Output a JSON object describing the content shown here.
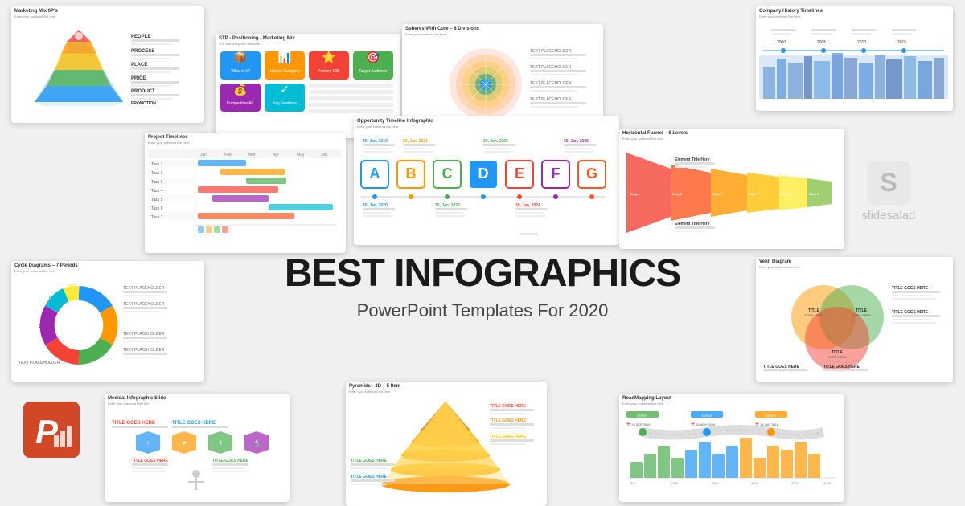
{
  "page": {
    "title": "Best Infographics PowerPoint Templates For 2020",
    "main_title": "BEST INFOGRAPHICS",
    "sub_title": "PowerPoint Templates For 2020"
  },
  "slides": {
    "marketing": {
      "title": "Marketing Mix 6P's",
      "subtitle": "Enter your subhead line here",
      "labels": [
        "PEOPLE",
        "PROCESS",
        "PLACE",
        "PRICE",
        "PRODUCT",
        "PROMOTION"
      ]
    },
    "stp": {
      "title": "STP - Positioning - Marketing Mix",
      "subtitle": "STP Marketing Mix Template",
      "cells": [
        "What is it?",
        "Market Category",
        "Primary Differentiation",
        "Target Audience",
        "Competitive Alternatives",
        "Key Features"
      ]
    },
    "spheres": {
      "title": "Spheres With Core – 8 Divisions",
      "subtitle": "Enter your subhead line here"
    },
    "company": {
      "title": "Company History Timelines",
      "subtitle": "Enter your subhead line here"
    },
    "project": {
      "title": "Project Timelines",
      "subtitle": "Enter your subhead line here"
    },
    "opportunity": {
      "title": "Opportunity Timeline Infographic",
      "subtitle": "Enter your subhead line here",
      "letters": [
        "A",
        "B",
        "C",
        "D",
        "E",
        "F",
        "G"
      ]
    },
    "funnel": {
      "title": "Horizontal Funnel – 6 Levels",
      "subtitle": "Enter your subhead line here"
    },
    "cycle": {
      "title": "Cycle Diagrams – 7 Periods",
      "subtitle": "Enter your subhead line here",
      "labels": [
        "01",
        "02",
        "03",
        "04",
        "05",
        "06",
        "07"
      ]
    },
    "venn": {
      "title": "Venn Diagram",
      "subtitle": "Enter your subhead line here"
    },
    "ppt": {
      "label": "P"
    },
    "medical": {
      "title": "Medical Infographic Slide",
      "subtitle": "Enter your subhead line here"
    },
    "pyramids": {
      "title": "Pyramids - 3D – 5 Item",
      "subtitle": "Enter your subhead line here"
    },
    "roadmap": {
      "title": "RoadMapping Layout",
      "subtitle": "Enter your subhead line here"
    }
  },
  "logo": {
    "letter": "S",
    "name": "slidesalad"
  },
  "colors": {
    "accent_blue": "#2196F3",
    "accent_red": "#F44336",
    "accent_green": "#4CAF50",
    "accent_orange": "#FF9800",
    "accent_purple": "#9C27B0",
    "accent_teal": "#009688",
    "ppt_red": "#D24726"
  }
}
